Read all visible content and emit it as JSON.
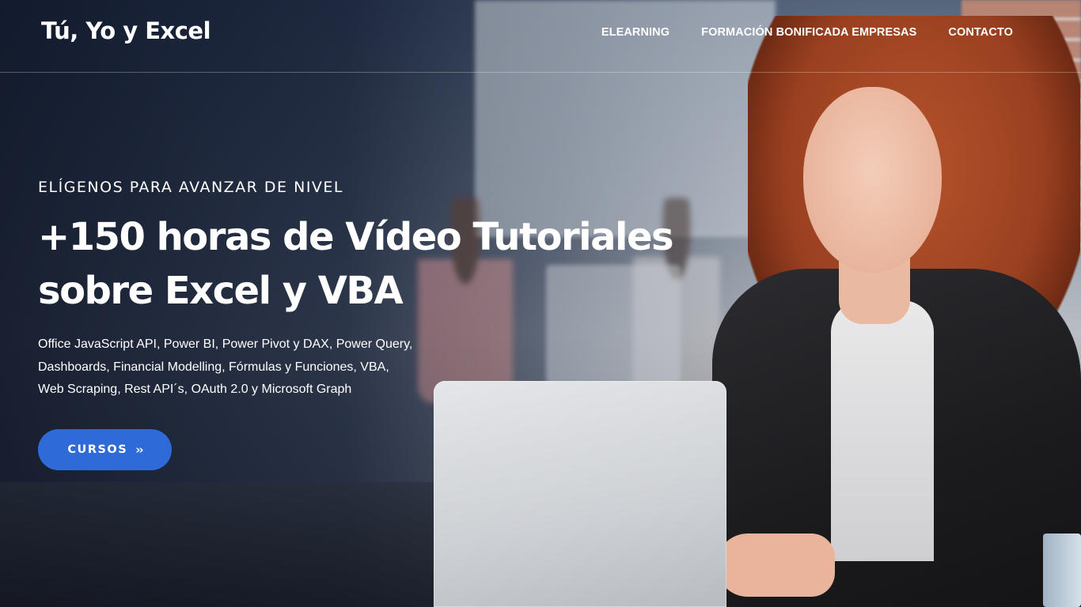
{
  "header": {
    "logo": "Tú, Yo y Excel",
    "nav": [
      "ELEARNING",
      "FORMACIÓN BONIFICADA EMPRESAS",
      "CONTACTO"
    ]
  },
  "hero": {
    "eyebrow": "ELÍGENOS PARA AVANZAR DE NIVEL",
    "headline": [
      "+150 horas de Vídeo Tutoriales",
      "sobre Excel y VBA"
    ],
    "description": [
      "Office JavaScript API, Power BI, Power Pivot y DAX, Power Query,",
      "Dashboards, Financial Modelling, Fórmulas y Funciones, VBA,",
      "Web Scraping, Rest API´s, OAuth 2.0 y Microsoft Graph"
    ],
    "cta_label": "CURSOS",
    "cta_icon": "chevron-double-right-icon"
  },
  "colors": {
    "accent": "#2f6bd8",
    "text": "#ffffff"
  }
}
